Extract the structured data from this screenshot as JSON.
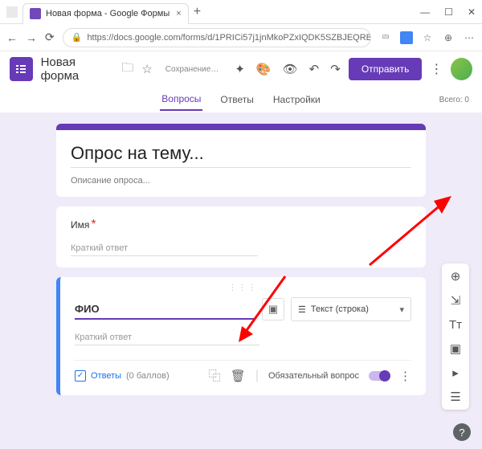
{
  "browser": {
    "tab_title": "Новая форма - Google Формы",
    "url": "https://docs.google.com/forms/d/1PRICi57j1jnMkoPZxIQDK5SZBJEQRBTO"
  },
  "appbar": {
    "title": "Новая форма",
    "saving": "Сохранение…",
    "send": "Отправить"
  },
  "tabs": {
    "questions": "Вопросы",
    "answers": "Ответы",
    "settings": "Настройки",
    "total": "Всего: 0"
  },
  "form": {
    "title": "Опрос на тему...",
    "description": "Описание опроса..."
  },
  "q1": {
    "label": "Имя",
    "placeholder": "Краткий ответ"
  },
  "q2": {
    "label": "ФИО",
    "type": "Текст (строка)",
    "placeholder": "Краткий ответ",
    "answers_label": "Ответы",
    "points": "(0 баллов)",
    "required_label": "Обязательный вопрос"
  }
}
